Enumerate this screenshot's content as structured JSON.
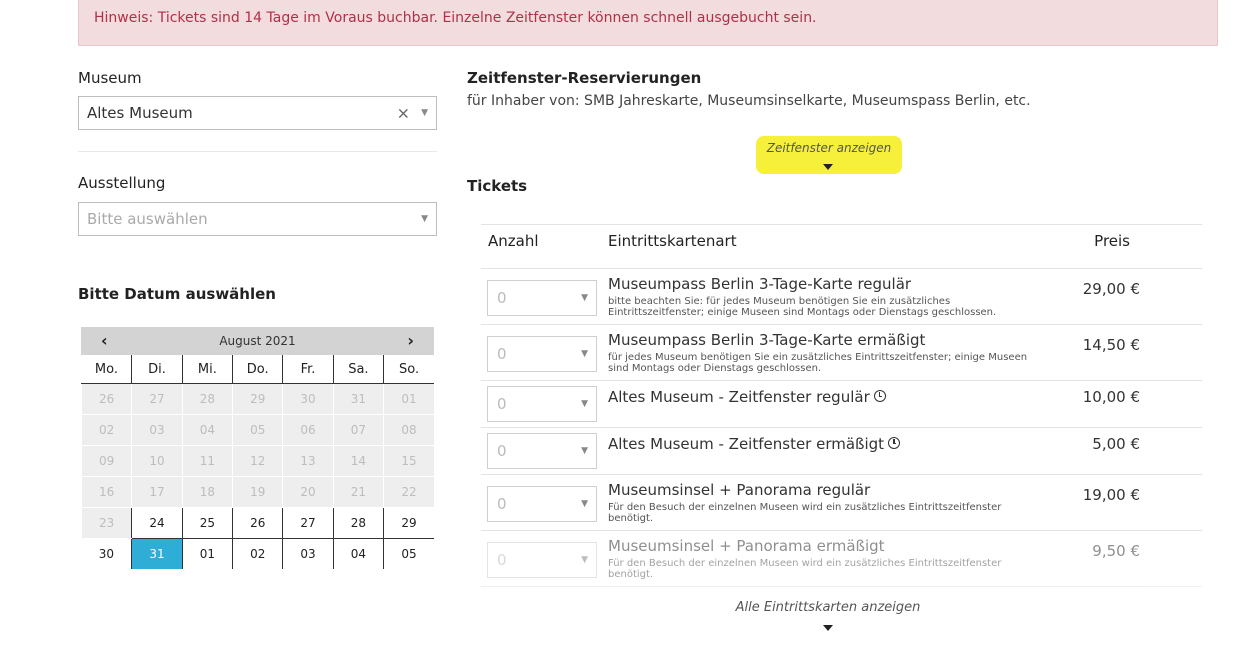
{
  "notice": "Hinweis: Tickets sind 14 Tage im Voraus buchbar. Einzelne Zeitfenster können schnell ausgebucht sein.",
  "museum": {
    "label": "Museum",
    "value": "Altes Museum"
  },
  "exhibition": {
    "label": "Ausstellung",
    "placeholder": "Bitte auswählen"
  },
  "date_label": "Bitte Datum auswählen",
  "calendar": {
    "month": "August 2021",
    "weekdays": [
      "Mo.",
      "Di.",
      "Mi.",
      "Do.",
      "Fr.",
      "Sa.",
      "So."
    ],
    "weeks": [
      [
        "26",
        "27",
        "28",
        "29",
        "30",
        "31",
        "01"
      ],
      [
        "02",
        "03",
        "04",
        "05",
        "06",
        "07",
        "08"
      ],
      [
        "09",
        "10",
        "11",
        "12",
        "13",
        "14",
        "15"
      ],
      [
        "16",
        "17",
        "18",
        "19",
        "20",
        "21",
        "22"
      ],
      [
        "23",
        "24",
        "25",
        "26",
        "27",
        "28",
        "29"
      ],
      [
        "30",
        "31",
        "01",
        "02",
        "03",
        "04",
        "05"
      ]
    ],
    "selected": "31"
  },
  "timeslot": {
    "title": "Zeitfenster-Reservierungen",
    "subtitle": "für Inhaber von: SMB Jahreskarte, Museumsinselkarte, Museumspass Berlin, etc.",
    "toggle": "Zeitfenster anzeigen"
  },
  "tickets": {
    "title": "Tickets",
    "col_qty": "Anzahl",
    "col_type": "Eintrittskartenart",
    "col_price": "Preis",
    "rows": [
      {
        "qty": "0",
        "name": "Museumpass Berlin 3-Tage-Karte regulär",
        "note": "bitte beachten Sie: für jedes Museum benötigen Sie ein zusätzliches Eintrittszeitfenster; einige Museen sind Montags oder Dienstags geschlossen.",
        "price": "29,00 €"
      },
      {
        "qty": "0",
        "name": "Museumpass Berlin 3-Tage-Karte ermäßigt",
        "note": "für jedes Museum benötigen Sie ein zusätzliches Eintrittszeitfenster; einige Museen sind Montags oder Dienstags geschlossen.",
        "price": "14,50 €"
      },
      {
        "qty": "0",
        "name": "Altes Museum - Zeitfenster regulär",
        "note": "",
        "price": "10,00 €"
      },
      {
        "qty": "0",
        "name": "Altes Museum - Zeitfenster ermäßigt",
        "note": "",
        "price": "5,00 €"
      },
      {
        "qty": "0",
        "name": "Museumsinsel + Panorama regulär",
        "note": "Für den Besuch der einzelnen Museen wird ein zusätzliches Eintrittszeitfenster benötigt.",
        "price": "19,00 €"
      },
      {
        "qty": "0",
        "name": "Museumsinsel + Panorama ermäßigt",
        "note": "Für den Besuch der einzelnen Museen wird ein zusätzliches Eintrittszeitfenster benötigt.",
        "price": "9,50 €"
      }
    ],
    "show_all": "Alle Eintrittskarten anzeigen"
  }
}
